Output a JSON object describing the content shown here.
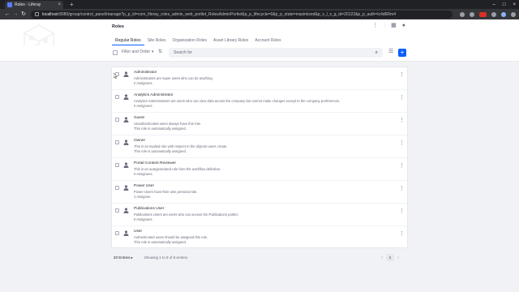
{
  "browser": {
    "tab_title": "Roles - Liferay",
    "url_host": "localhost",
    "url_rest": ":8080/group/control_panel/manage?p_p_id=com_liferay_roles_admin_web_portlet_RolesAdminPortlet&p_p_lifecycle=0&p_p_state=maximized&p_v_l_s_g_id=20123&p_p_auth=Ic4d6Rm4"
  },
  "header": {
    "title": "Roles",
    "tabs": [
      {
        "label": "Regular Roles",
        "active": true
      },
      {
        "label": "Site Roles",
        "active": false
      },
      {
        "label": "Organization Roles",
        "active": false
      },
      {
        "label": "Asset Library Roles",
        "active": false
      },
      {
        "label": "Account Roles",
        "active": false
      }
    ]
  },
  "management": {
    "filter_label": "Filter and Order",
    "search_placeholder": "Search for"
  },
  "roles": [
    {
      "title": "Administrator",
      "description": "Administrators are super users who can do anything.",
      "sub": "2 Assignees"
    },
    {
      "title": "Analytics Administrator",
      "description": "Analytics Administrators are users who can view data across the company but cannot make changes except to the company preferences.",
      "sub": "0 Assignees"
    },
    {
      "title": "Guest",
      "description": "Unauthenticated users always have this role.",
      "sub": "This role is automatically assigned."
    },
    {
      "title": "Owner",
      "description": "This is an implied role with respect to the objects users create.",
      "sub": "This role is automatically assigned."
    },
    {
      "title": "Portal Content Reviewer",
      "description": "This is an autogenerated role from the workflow definition.",
      "sub": "0 Assignees"
    },
    {
      "title": "Power User",
      "description": "Power Users have their own personal site.",
      "sub": "1 Assignee"
    },
    {
      "title": "Publications User",
      "description": "Publications Users are users who can access the Publications portlet.",
      "sub": "0 Assignees"
    },
    {
      "title": "User",
      "description": "Authenticated users should be assigned this role.",
      "sub": "This role is automatically assigned."
    }
  ],
  "pagination": {
    "entries_label": "20 Entries",
    "showing_label": "Showing 1 to 8 of 8 entries.",
    "current_page": "1"
  },
  "colors": {
    "primary": "#0b5fff",
    "text": "#272833",
    "secondary_text": "#6b6c7e",
    "background": "#f1f2f5"
  }
}
